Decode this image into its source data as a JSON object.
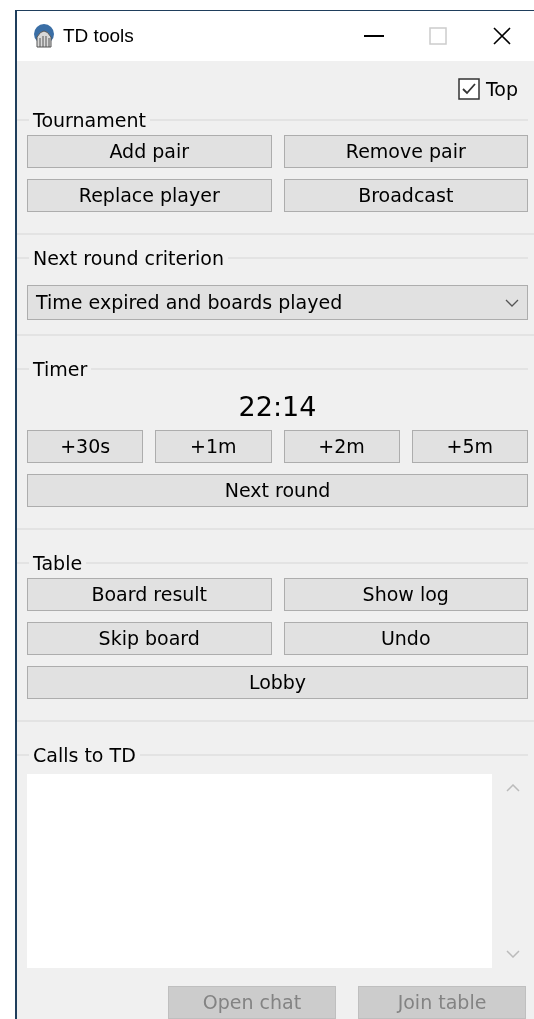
{
  "window": {
    "title": "TD tools"
  },
  "top_checkbox": {
    "label": "Top",
    "checked": true
  },
  "tournament": {
    "title": "Tournament",
    "rows": [
      [
        {
          "label": "Add pair",
          "disabled": false
        },
        {
          "label": "Remove pair",
          "disabled": false
        }
      ],
      [
        {
          "label": "Replace player",
          "disabled": false
        },
        {
          "label": "Broadcast",
          "disabled": false
        }
      ]
    ]
  },
  "criterion": {
    "title": "Next round criterion",
    "value": "Time expired and boards played"
  },
  "timer": {
    "title": "Timer",
    "time": "22:14",
    "rows": [
      [
        {
          "label": "+30s",
          "disabled": false
        },
        {
          "label": "+1m",
          "disabled": false
        },
        {
          "label": "+2m",
          "disabled": false
        },
        {
          "label": "+5m",
          "disabled": false
        }
      ],
      [
        {
          "label": "Next round",
          "disabled": false
        }
      ]
    ]
  },
  "table": {
    "title": "Table",
    "rows": [
      [
        {
          "label": "Board result",
          "disabled": false
        },
        {
          "label": "Show log",
          "disabled": false
        }
      ],
      [
        {
          "label": "Skip board",
          "disabled": false
        },
        {
          "label": "Undo",
          "disabled": false
        }
      ],
      [
        {
          "label": "Lobby",
          "disabled": false
        }
      ]
    ]
  },
  "calls": {
    "title": "Calls to TD",
    "buttons": [
      {
        "label": "Open chat",
        "disabled": true
      },
      {
        "label": "Join table",
        "disabled": true
      }
    ]
  }
}
